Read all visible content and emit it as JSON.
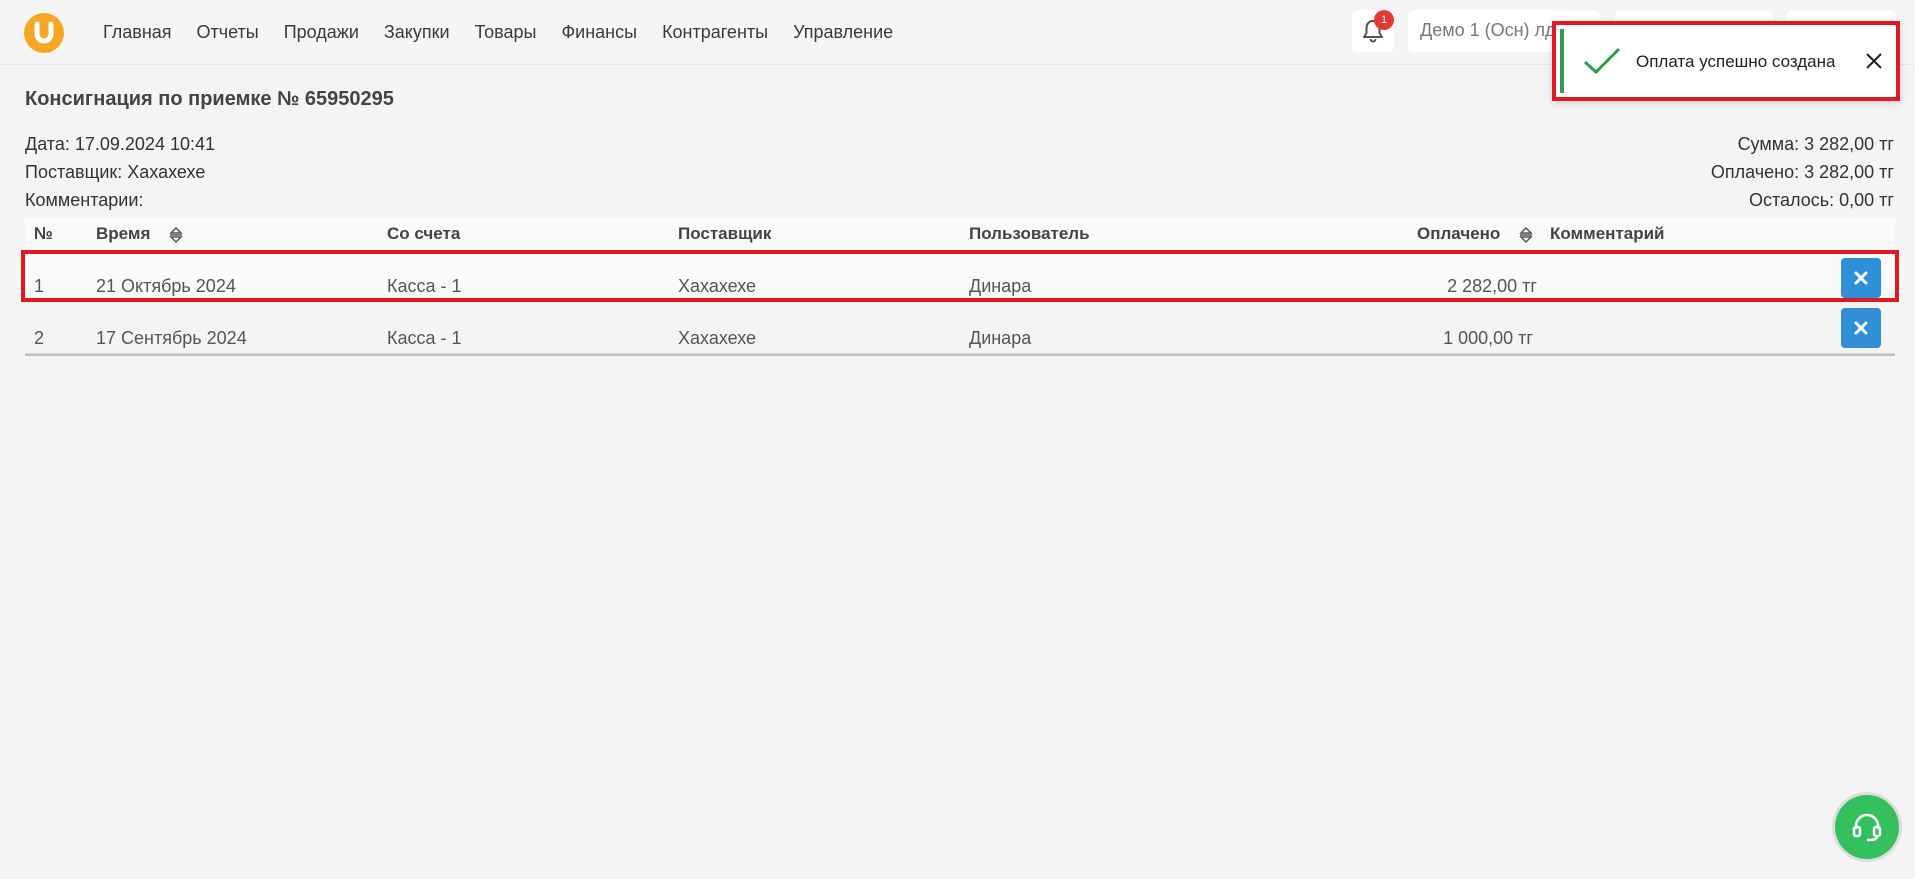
{
  "nav": {
    "items": [
      "Главная",
      "Отчеты",
      "Продажи",
      "Закупки",
      "Товары",
      "Финансы",
      "Контрагенты",
      "Управление"
    ]
  },
  "header": {
    "notifications_count": "1",
    "company": "Демо 1 (Осн) лд"
  },
  "toast": {
    "message": "Оплата успешно создана",
    "accent_color": "#2e9e4e"
  },
  "page": {
    "title": "Консигнация по приемке № 65950295",
    "date": "Дата: 17.09.2024 10:41",
    "supplier": "Поставщик: Хахахехе",
    "comments": "Комментарии:",
    "sum": "Сумма: 3 282,00 тг",
    "paid": "Оплачено: 3 282,00 тг",
    "remaining": "Осталось: 0,00 тг"
  },
  "table": {
    "headers": {
      "num": "№",
      "time": "Время",
      "account": "Со счета",
      "supplier": "Поставщик",
      "user": "Пользователь",
      "paid": "Оплачено",
      "comment": "Комментарий"
    },
    "rows": [
      {
        "num": "1",
        "time": "21 Октябрь 2024",
        "account": "Касса - 1",
        "supplier": "Хахахехе",
        "user": "Динара",
        "paid": "2 282,00 тг",
        "comment": ""
      },
      {
        "num": "2",
        "time": "17 Сентябрь 2024",
        "account": "Касса - 1",
        "supplier": "Хахахехе",
        "user": "Динара",
        "paid": "1 000,00 тг",
        "comment": ""
      }
    ]
  },
  "colors": {
    "brand": "#f5a623",
    "highlight": "#e01a22",
    "delete_button": "#2f8fd8",
    "support_button": "#34c05e"
  }
}
